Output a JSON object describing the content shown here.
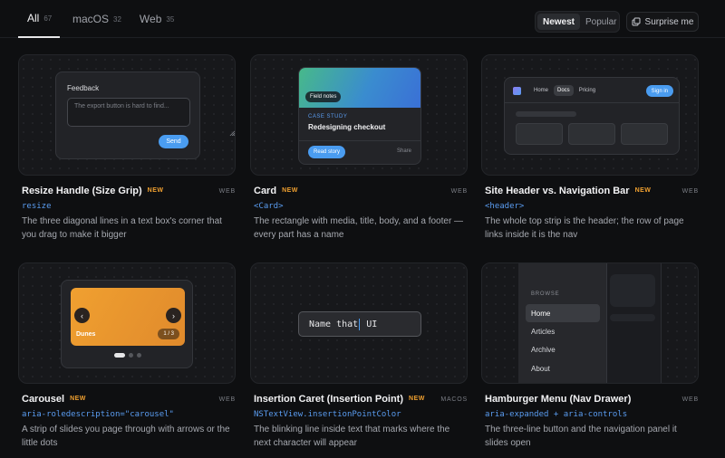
{
  "tabs": [
    {
      "label": "All",
      "count": "67"
    },
    {
      "label": "macOS",
      "count": "32"
    },
    {
      "label": "Web",
      "count": "35"
    }
  ],
  "sort": {
    "newest": "Newest",
    "popular": "Popular"
  },
  "surprise_label": "Surprise me",
  "new_badge": "NEW",
  "cards": [
    {
      "title": "Resize Handle (Size Grip)",
      "platform": "WEB",
      "code": "resize",
      "desc": "The three diagonal lines in a text box's corner that you drag to make it bigger",
      "preview": {
        "label": "Feedback",
        "text": "The export button is hard to find...",
        "button": "Send"
      }
    },
    {
      "title": "Card",
      "platform": "WEB",
      "code": "<Card>",
      "desc": "The rectangle with media, title, body, and a footer — every part has a name",
      "preview": {
        "chip": "Field notes",
        "eyebrow": "CASE STUDY",
        "title": "Redesigning checkout",
        "primary": "Read story",
        "secondary": "Share"
      }
    },
    {
      "title": "Site Header vs. Navigation Bar",
      "platform": "WEB",
      "code": "<header>",
      "desc": "The whole top strip is the header; the row of page links inside it is the nav",
      "preview": {
        "links": [
          "Home",
          "Docs",
          "Pricing"
        ],
        "button": "Sign in"
      }
    },
    {
      "title": "Carousel",
      "platform": "WEB",
      "code": "aria-roledescription=\"carousel\"",
      "desc": "A strip of slides you page through with arrows or the little dots",
      "preview": {
        "slide": "Dunes",
        "counter": "1 / 3",
        "current_slide": 1,
        "total_slides": 3
      }
    },
    {
      "title": "Insertion Caret (Insertion Point)",
      "platform": "MACOS",
      "code": "NSTextView.insertionPointColor",
      "desc": "The blinking line inside text that marks where the next character will appear",
      "preview": {
        "before": "Name that",
        "after": " UI"
      }
    },
    {
      "title": "Hamburger Menu (Nav Drawer)",
      "platform": "WEB",
      "code": "aria-expanded + aria-controls",
      "desc": "The three-line button and the navigation panel it slides open",
      "preview": {
        "caption": "BROWSE",
        "items": [
          "Home",
          "Articles",
          "Archive",
          "About"
        ]
      }
    }
  ]
}
